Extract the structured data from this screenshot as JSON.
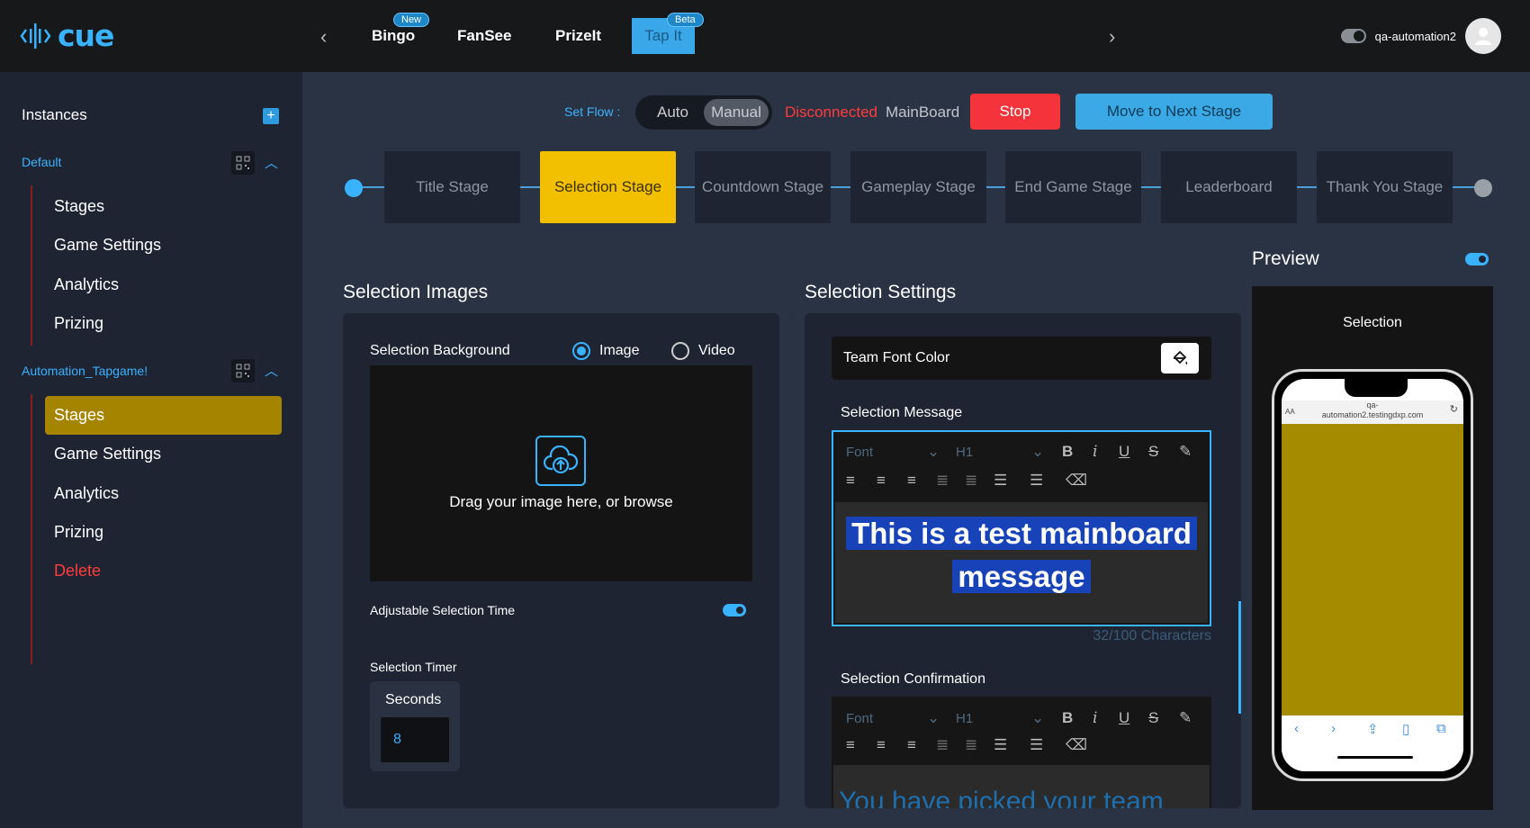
{
  "brand": {
    "name": "cue"
  },
  "topnav": {
    "tabs": [
      {
        "label": "Bingo",
        "badge": "New"
      },
      {
        "label": "FanSee"
      },
      {
        "label": "PrizeIt"
      },
      {
        "label": "Tap It",
        "badge": "Beta"
      }
    ],
    "username": "qa-automation2"
  },
  "sidebar": {
    "title": "Instances",
    "groups": [
      {
        "name": "Default",
        "items": [
          "Stages",
          "Game Settings",
          "Analytics",
          "Prizing"
        ]
      },
      {
        "name": "Automation_Tapgame!",
        "items": [
          "Stages",
          "Game Settings",
          "Analytics",
          "Prizing",
          "Delete"
        ]
      }
    ]
  },
  "flow": {
    "label": "Set Flow :",
    "options": [
      "Auto",
      "Manual"
    ],
    "selected": "Manual",
    "status": "Disconnected",
    "board": "MainBoard",
    "stop_label": "Stop",
    "next_label": "Move to Next Stage"
  },
  "stages": [
    "Title Stage",
    "Selection Stage",
    "Countdown Stage",
    "Gameplay Stage",
    "End Game Stage",
    "Leaderboard",
    "Thank You Stage"
  ],
  "active_stage": "Selection Stage",
  "selection_images": {
    "title": "Selection Images",
    "background_label": "Selection Background",
    "media_options": [
      "Image",
      "Video"
    ],
    "media_selected": "Image",
    "drop_text": "Drag your image here, or browse",
    "adjustable_label": "Adjustable Selection Time",
    "adjustable_on": true,
    "timer_label": "Selection Timer",
    "seconds_label": "Seconds",
    "seconds_value": "8"
  },
  "selection_settings": {
    "title": "Selection Settings",
    "team_font_color_label": "Team Font Color",
    "message_label": "Selection Message",
    "editor_font": "Font",
    "editor_heading": "H1",
    "message_line1": "This is a test mainboard",
    "message_line2": "message",
    "char_count": "32/100 Characters",
    "confirmation_label": "Selection Confirmation",
    "confirmation_text": "You have picked your team"
  },
  "preview": {
    "title": "Preview",
    "enabled": true,
    "screen_label": "Selection",
    "url_line1": "qa-",
    "url_line2": "automation2.testingdxp.com",
    "url_prefix": "AA",
    "screen_color": "#a58b00"
  },
  "colors": {
    "accent": "#3ab3ff",
    "active_stage": "#f2c000",
    "stop": "#f5333a",
    "sidebar_active": "#a58500"
  }
}
